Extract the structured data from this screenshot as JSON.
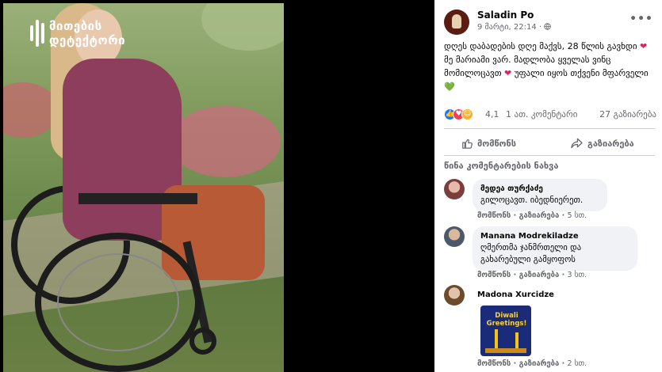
{
  "logo": {
    "line1": "მითების",
    "line2": "დეტექტორი"
  },
  "post": {
    "author": "Saladin Po",
    "time": "9 მარტი, 22:14 · ",
    "privacy_icon": "globe-icon",
    "more_icon": "more-dots-icon",
    "text_1": "დღეს დაბადების დღე მაქვს, 28 წლის გავხდი",
    "text_2": "მე მარიამი ვარ. მადლობა ყველას ვინც მომილოცავთ",
    "text_3": "უფალი იყოს თქვენი მფარველი",
    "heart": "❤",
    "green_heart": "💚"
  },
  "stats": {
    "reaction_count": "4,1",
    "comments": "1 ათ. კომენტარი",
    "shares": "27 გაზიარება"
  },
  "actions": {
    "like": "მომწონს",
    "share": "გაზიარება"
  },
  "prev_comments_label": "წინა კომენტარების ნახვა",
  "comments": [
    {
      "name": "მედეა თურქაძე",
      "text": "გილოცავთ. იბედნიერეთ.",
      "like": "მომწონს",
      "share": "გაზიარება",
      "time": "5 სთ."
    },
    {
      "name": "Manana Modrekiladze",
      "text": "ღმერთმა ჯანმრთელი და გახარებული გამყოფოს",
      "like": "მომწონს",
      "share": "გაზიარება",
      "time": "3 სთ."
    },
    {
      "name": "Madona Xurcidze",
      "sticker_text": "Diwali Greetings!",
      "like": "მომწონს",
      "share": "გაზიარება",
      "time": "2 სთ."
    }
  ],
  "colors": {
    "like_blue": "#1877f2",
    "love_red": "#f33e58",
    "care_yellow": "#f7b125",
    "text_secondary": "#65676b",
    "bubble_bg": "#f0f2f5"
  }
}
